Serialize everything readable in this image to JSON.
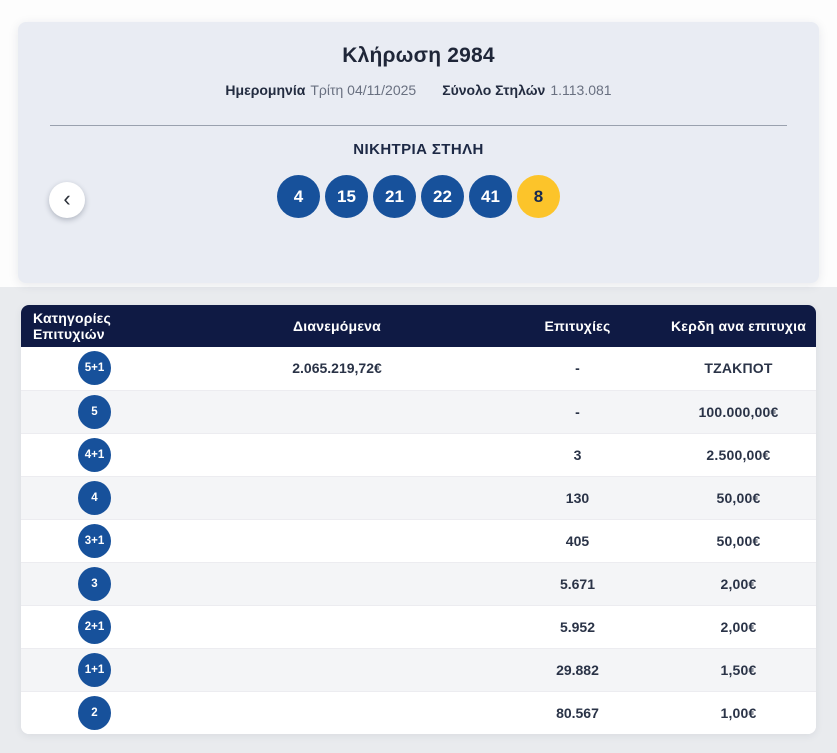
{
  "draw": {
    "title": "Κλήρωση 2984",
    "date_label": "Ημερομηνία",
    "date_value": "Τρίτη 04/11/2025",
    "columns_label": "Σύνολο Στηλών",
    "columns_value": "1.113.081",
    "winning_title": "ΝΙΚΗΤΡΙΑ ΣΤΗΛΗ",
    "numbers": [
      "4",
      "15",
      "21",
      "22",
      "41"
    ],
    "joker": "8"
  },
  "icons": {
    "chevron_left": "‹"
  },
  "colors": {
    "ball_blue": "#17519b",
    "joker_yellow": "#fcc42a",
    "header_navy": "#0f1a44",
    "card_bg": "#e9ecf3"
  },
  "table": {
    "headers": [
      "Κατηγορίες Επιτυχιών",
      "Διανεμόμενα",
      "Επιτυχίες",
      "Κερδη ανα επιτυχια"
    ],
    "rows": [
      {
        "category": "5+1",
        "distributed": "2.065.219,72€",
        "winners": "-",
        "prize": "ΤΖΑΚΠΟΤ"
      },
      {
        "category": "5",
        "distributed": "",
        "winners": "-",
        "prize": "100.000,00€"
      },
      {
        "category": "4+1",
        "distributed": "",
        "winners": "3",
        "prize": "2.500,00€"
      },
      {
        "category": "4",
        "distributed": "",
        "winners": "130",
        "prize": "50,00€"
      },
      {
        "category": "3+1",
        "distributed": "",
        "winners": "405",
        "prize": "50,00€"
      },
      {
        "category": "3",
        "distributed": "",
        "winners": "5.671",
        "prize": "2,00€"
      },
      {
        "category": "2+1",
        "distributed": "",
        "winners": "5.952",
        "prize": "2,00€"
      },
      {
        "category": "1+1",
        "distributed": "",
        "winners": "29.882",
        "prize": "1,50€"
      },
      {
        "category": "2",
        "distributed": "",
        "winners": "80.567",
        "prize": "1,00€"
      }
    ]
  }
}
